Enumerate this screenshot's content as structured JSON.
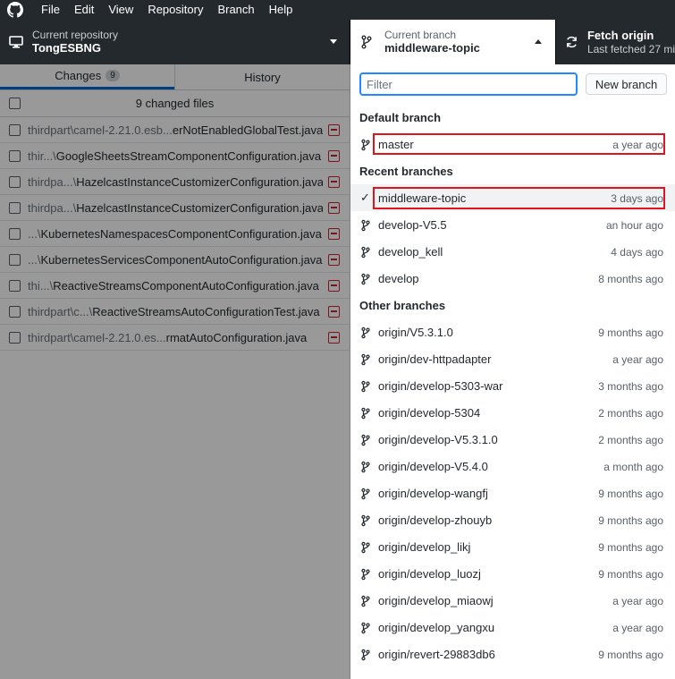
{
  "menu": [
    "File",
    "Edit",
    "View",
    "Repository",
    "Branch",
    "Help"
  ],
  "toolbar": {
    "repo_label": "Current repository",
    "repo_name": "TongESBNG",
    "branch_label": "Current branch",
    "branch_name": "middleware-topic",
    "fetch_title": "Fetch origin",
    "fetch_subtitle": "Last fetched 27 mi"
  },
  "changes": {
    "tab_changes": "Changes",
    "changes_count": "9",
    "tab_history": "History",
    "summary": "9 changed files",
    "files": [
      {
        "dir": "thirdpart\\camel-2.21.0.esb...",
        "name": "erNotEnabledGlobalTest.java"
      },
      {
        "dir": "thir...\\",
        "name": "GoogleSheetsStreamComponentConfiguration.java"
      },
      {
        "dir": "thirdpa...\\",
        "name": "HazelcastInstanceCustomizerConfiguration.java"
      },
      {
        "dir": "thirdpa...\\",
        "name": "HazelcastInstanceCustomizerConfiguration.java"
      },
      {
        "dir": "...\\",
        "name": "KubernetesNamespacesComponentConfiguration.java"
      },
      {
        "dir": "...\\",
        "name": "KubernetesServicesComponentAutoConfiguration.java"
      },
      {
        "dir": "thi...\\",
        "name": "ReactiveStreamsComponentAutoConfiguration.java"
      },
      {
        "dir": "thirdpart\\c...\\",
        "name": "ReactiveStreamsAutoConfigurationTest.java"
      },
      {
        "dir": "thirdpart\\camel-2.21.0.es...",
        "name": "rmatAutoConfiguration.java"
      }
    ]
  },
  "branches": {
    "filter_placeholder": "Filter",
    "new_branch": "New branch",
    "default_header": "Default branch",
    "default": [
      {
        "name": "master",
        "time": "a year ago"
      }
    ],
    "recent_header": "Recent branches",
    "recent": [
      {
        "name": "middleware-topic",
        "time": "3 days ago"
      },
      {
        "name": "develop-V5.5",
        "time": "an hour ago"
      },
      {
        "name": "develop_kell",
        "time": "4 days ago"
      },
      {
        "name": "develop",
        "time": "8 months ago"
      }
    ],
    "other_header": "Other branches",
    "other": [
      {
        "name": "origin/V5.3.1.0",
        "time": "9 months ago"
      },
      {
        "name": "origin/dev-httpadapter",
        "time": "a year ago"
      },
      {
        "name": "origin/develop-5303-war",
        "time": "3 months ago"
      },
      {
        "name": "origin/develop-5304",
        "time": "2 months ago"
      },
      {
        "name": "origin/develop-V5.3.1.0",
        "time": "2 months ago"
      },
      {
        "name": "origin/develop-V5.4.0",
        "time": "a month ago"
      },
      {
        "name": "origin/develop-wangfj",
        "time": "9 months ago"
      },
      {
        "name": "origin/develop-zhouyb",
        "time": "9 months ago"
      },
      {
        "name": "origin/develop_likj",
        "time": "9 months ago"
      },
      {
        "name": "origin/develop_luozj",
        "time": "9 months ago"
      },
      {
        "name": "origin/develop_miaowj",
        "time": "a year ago"
      },
      {
        "name": "origin/develop_yangxu",
        "time": "a year ago"
      },
      {
        "name": "origin/revert-29883db6",
        "time": "9 months ago"
      }
    ]
  },
  "colors": {
    "highlight": "#e0141c",
    "accent": "#2188ff",
    "toolbar_bg": "#24292e"
  }
}
